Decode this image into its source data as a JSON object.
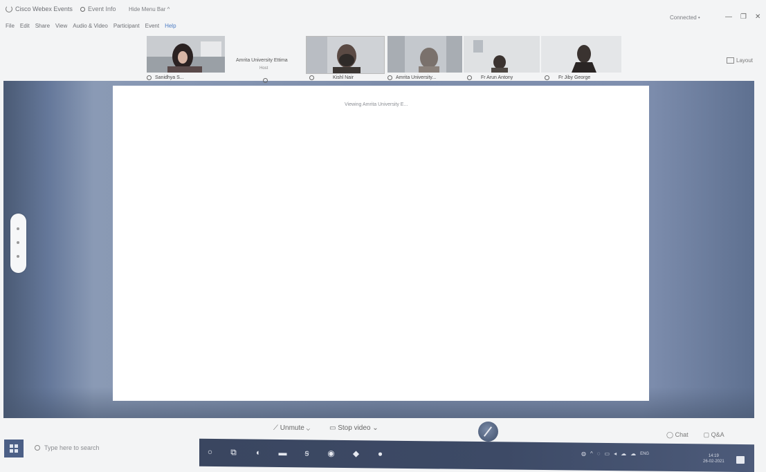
{
  "titlebar": {
    "app_title": "Cisco Webex Events",
    "meeting_info": "Event Info",
    "hide_menu": "Hide Menu Bar ^",
    "connected": "Connected •",
    "minimize": "—",
    "restore": "❐",
    "close": "✕"
  },
  "menu": {
    "items": [
      "File",
      "Edit",
      "Share",
      "View",
      "Audio & Video",
      "Participant",
      "Event",
      "Help"
    ]
  },
  "layout_label": "Layout",
  "participants": [
    {
      "name": "Sanidhya S..."
    },
    {
      "name": "Amrita University Ettima",
      "sub": "Host"
    },
    {
      "name": "Kishl Nair"
    },
    {
      "name": "Amrita University..."
    },
    {
      "name": "Fr Arun Antony"
    },
    {
      "name": "Fr Jiby George"
    }
  ],
  "share": {
    "viewing_label": "Viewing Amrita University E..."
  },
  "controls": {
    "unmute": "Unmute",
    "stop_video": "Stop video",
    "chat": "Chat",
    "qa": "Q&A"
  },
  "taskbar": {
    "search_placeholder": "Type here to search",
    "lang": "ENG",
    "time": "14:19",
    "date": "26-02-2021"
  },
  "colors": {
    "stage_blue": "#7d8dab",
    "taskbar": "#3a4660",
    "active_menu": "#4c7cc4"
  }
}
